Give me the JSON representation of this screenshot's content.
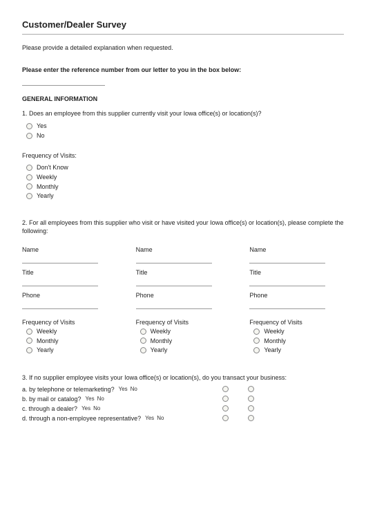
{
  "title": "Customer/Dealer Survey",
  "intro": "Please provide a detailed explanation when requested.",
  "refLabel": "Please enter the reference number from our letter to you in the box below:",
  "sectionGeneral": "GENERAL INFORMATION",
  "q1": {
    "text": "1. Does an employee from this supplier currently visit your Iowa office(s) or location(s)?",
    "options": [
      "Yes",
      "No"
    ]
  },
  "freqLabel": "Frequency of Visits:",
  "freqOptions": [
    "Don't Know",
    "Weekly",
    "Monthly",
    "Yearly"
  ],
  "q2": {
    "text": "2. For all employees from this supplier who visit or have visited your Iowa office(s) or location(s), please complete the following:",
    "fields": {
      "name": "Name",
      "title": "Title",
      "phone": "Phone"
    },
    "fovLabel": "Frequency of Visits",
    "fovOptions": [
      "Weekly",
      "Monthly",
      "Yearly"
    ]
  },
  "q3": {
    "text": "3. If no supplier employee visits your Iowa office(s) or location(s), do you transact your business:",
    "items": [
      "a. by telephone or telemarketing?",
      "b. by mail or catalog?",
      "c. through a dealer?",
      "d. through a non-employee representative?"
    ],
    "yes": "Yes",
    "no": "No"
  }
}
